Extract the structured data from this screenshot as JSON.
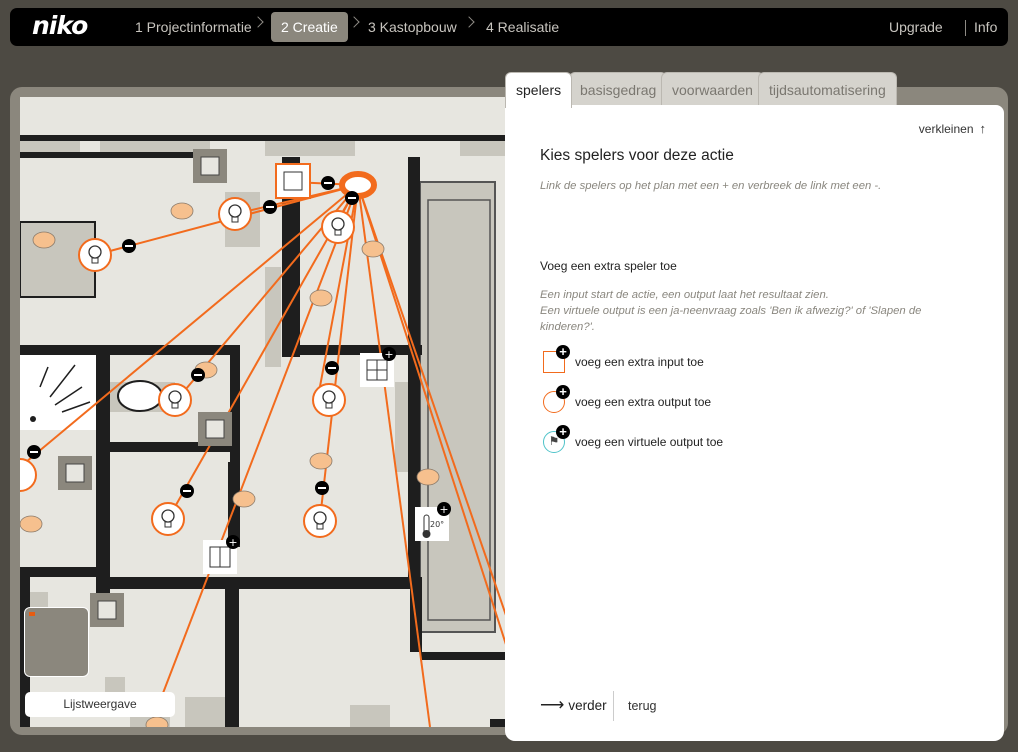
{
  "nav": {
    "logo": "niko",
    "steps": [
      {
        "label": "1 Projectinformatie"
      },
      {
        "label": "2 Creatie"
      },
      {
        "label": "3 Kastopbouw"
      },
      {
        "label": "4 Realisatie"
      }
    ],
    "active_step": 1,
    "upgrade": "Upgrade",
    "info": "Info"
  },
  "tabs": [
    {
      "label": "spelers"
    },
    {
      "label": "basisgedrag"
    },
    {
      "label": "voorwaarden"
    },
    {
      "label": "tijdsautomatisering"
    }
  ],
  "active_tab": 0,
  "panel": {
    "collapse_label": "verkleinen",
    "title": "Kies spelers voor deze actie",
    "hint": "Link de spelers op het plan met een + en verbreek de link met een -.",
    "section_title": "Voeg een extra speler toe",
    "section_desc_1": "Een input start de actie, een output laat het resultaat zien.",
    "section_desc_2": "Een virtuele output is een ja-neenvraag zoals 'Ben ik afwezig?' of 'Slapen de kinderen?'.",
    "add_input": "voeg een extra input toe",
    "add_output": "voeg een extra output toe",
    "add_virtual": "voeg een virtuele output toe",
    "next": "verder",
    "back": "terug"
  },
  "floorplan": {
    "list_view_label": "Lijstweergave",
    "thermostat_value": "20°"
  },
  "colors": {
    "accent": "#f26b1d",
    "nav_bg": "#000000",
    "workarea": "#8b877d",
    "wall": "#1e1e1e",
    "bubble": "#f6c08e",
    "virtual": "#4fc3c9"
  }
}
